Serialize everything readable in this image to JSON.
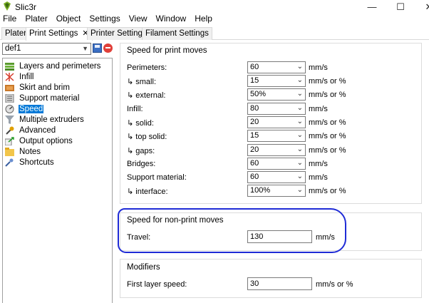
{
  "window": {
    "title": "Slic3r",
    "minimize_glyph": "—",
    "maximize_glyph": "☐",
    "close_glyph": "✕"
  },
  "menu": [
    "File",
    "Plater",
    "Object",
    "Settings",
    "View",
    "Window",
    "Help"
  ],
  "tabs": [
    {
      "label": "Plater",
      "active": false
    },
    {
      "label": "Print Settings",
      "active": true,
      "close_glyph": "✕"
    },
    {
      "label": "Printer Settings",
      "active": false
    },
    {
      "label": "Filament Settings",
      "active": false
    }
  ],
  "preset": {
    "value": "def1"
  },
  "tree": {
    "items": [
      {
        "label": "Layers and perimeters",
        "icon": "layers-icon"
      },
      {
        "label": "Infill",
        "icon": "infill-icon"
      },
      {
        "label": "Skirt and brim",
        "icon": "skirt-icon"
      },
      {
        "label": "Support material",
        "icon": "support-icon"
      },
      {
        "label": "Speed",
        "icon": "speed-icon",
        "selected": true
      },
      {
        "label": "Multiple extruders",
        "icon": "funnel-icon"
      },
      {
        "label": "Advanced",
        "icon": "wrench-icon"
      },
      {
        "label": "Output options",
        "icon": "output-icon"
      },
      {
        "label": "Notes",
        "icon": "notes-icon"
      },
      {
        "label": "Shortcuts",
        "icon": "shortcuts-icon"
      }
    ]
  },
  "speed_print": {
    "title": "Speed for print moves",
    "rows": [
      {
        "label": "Perimeters:",
        "value": "60",
        "unit": "mm/s"
      },
      {
        "label": "↳ small:",
        "value": "15",
        "unit": "mm/s or %"
      },
      {
        "label": "↳ external:",
        "value": "50%",
        "unit": "mm/s or %"
      },
      {
        "label": "Infill:",
        "value": "80",
        "unit": "mm/s"
      },
      {
        "label": "↳ solid:",
        "value": "20",
        "unit": "mm/s or %"
      },
      {
        "label": "↳ top solid:",
        "value": "15",
        "unit": "mm/s or %"
      },
      {
        "label": "↳ gaps:",
        "value": "20",
        "unit": "mm/s or %"
      },
      {
        "label": "Bridges:",
        "value": "60",
        "unit": "mm/s"
      },
      {
        "label": "Support material:",
        "value": "60",
        "unit": "mm/s"
      },
      {
        "label": "↳ interface:",
        "value": "100%",
        "unit": "mm/s or %"
      }
    ]
  },
  "speed_nonprint": {
    "title": "Speed for non-print moves",
    "travel": {
      "label": "Travel:",
      "value": "130",
      "unit": "mm/s"
    }
  },
  "modifiers": {
    "title": "Modifiers",
    "first_layer": {
      "label": "First layer speed:",
      "value": "30",
      "unit": "mm/s or %"
    }
  },
  "colors": {
    "selection": "#0078d7",
    "highlight_annotation": "#1f2bd6"
  }
}
